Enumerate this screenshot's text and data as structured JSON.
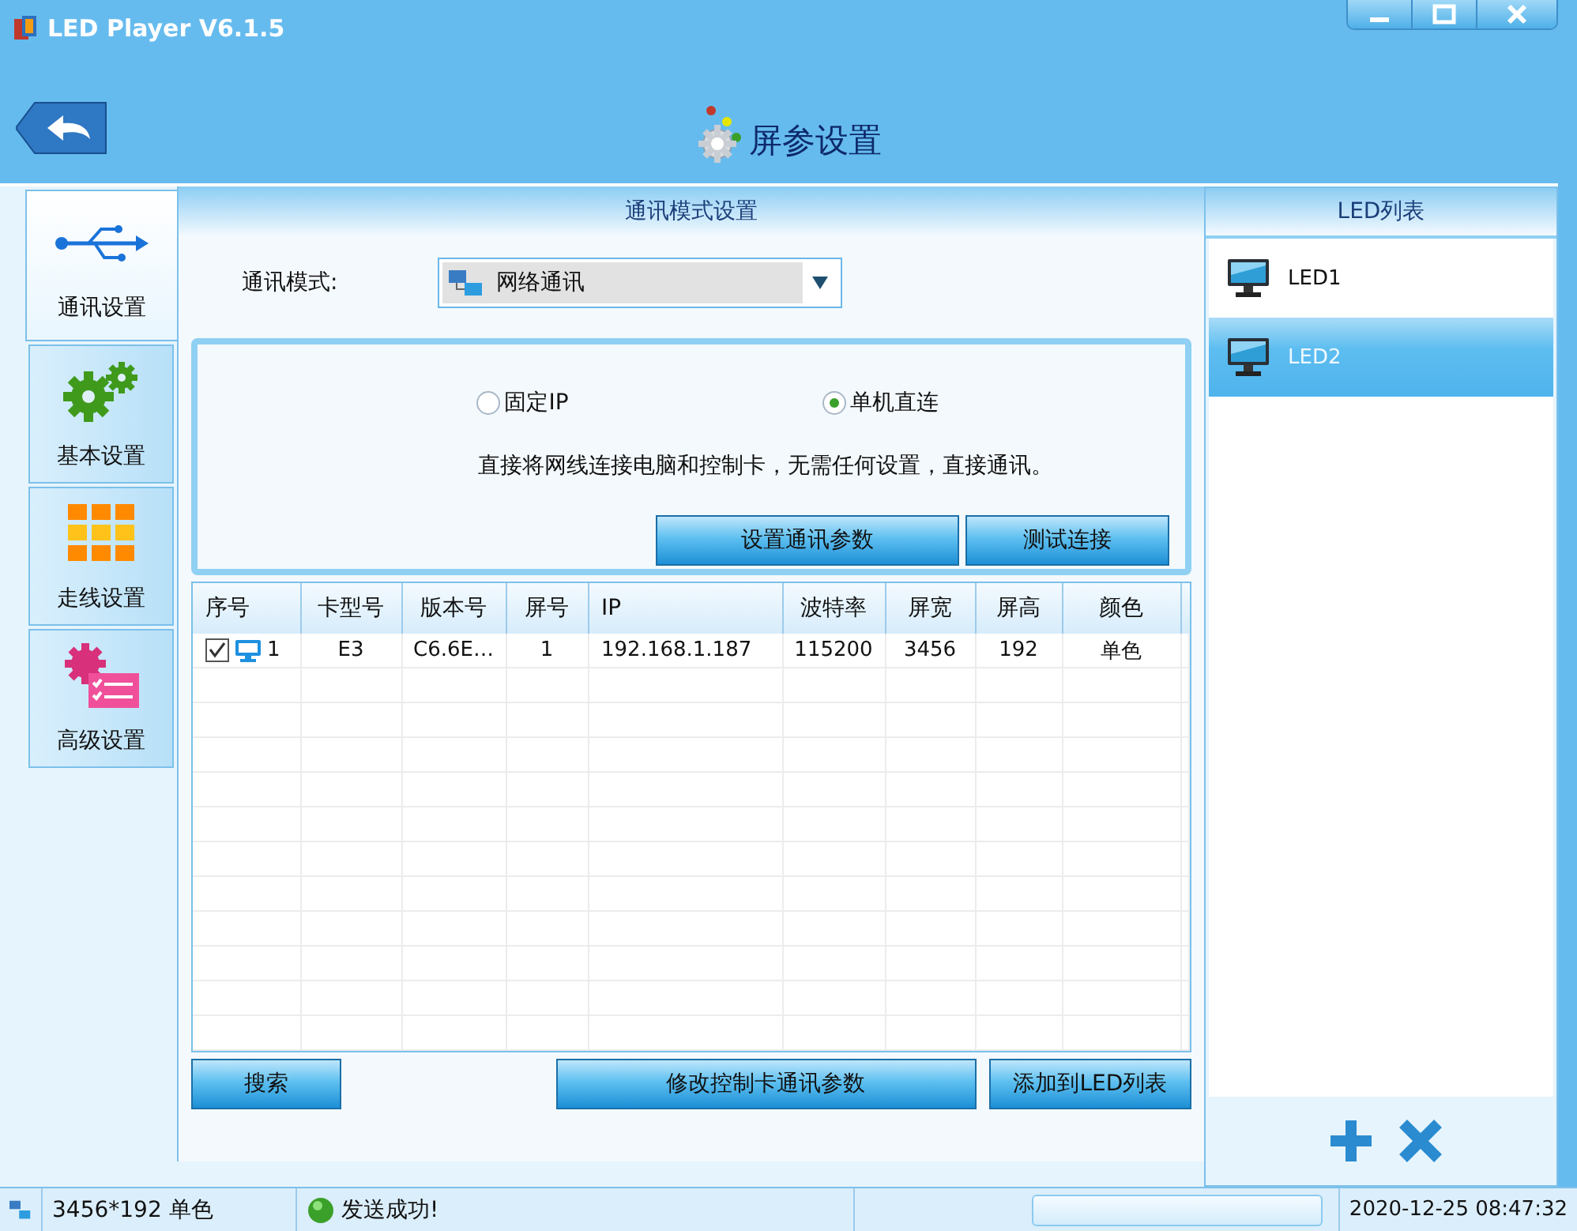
{
  "window": {
    "title": "LED Player V6.1.5"
  },
  "header": {
    "title": "屏参设置"
  },
  "nav": [
    {
      "label": "通讯设置",
      "selected": true,
      "kind": "usb"
    },
    {
      "label": "基本设置",
      "selected": false,
      "kind": "gears"
    },
    {
      "label": "走线设置",
      "selected": false,
      "kind": "grid"
    },
    {
      "label": "高级设置",
      "selected": false,
      "kind": "advanced"
    }
  ],
  "comm": {
    "title": "通讯模式设置",
    "mode_label": "通讯模式:",
    "mode_value": "网络通讯",
    "options": [
      {
        "label": "固定IP",
        "selected": false
      },
      {
        "label": "单机直连",
        "selected": true
      }
    ],
    "description": "直接将网线连接电脑和控制卡，无需任何设置，直接通讯。",
    "buttons": [
      "设置通讯参数",
      "测试连接"
    ]
  },
  "table": {
    "columns": [
      "序号",
      "卡型号",
      "版本号",
      "屏号",
      "IP",
      "波特率",
      "屏宽",
      "屏高",
      "颜色"
    ],
    "rows": [
      {
        "checked": true,
        "cells": [
          "1",
          "E3",
          "C6.6E…",
          "1",
          "192.168.1.187",
          "115200",
          "3456",
          "192",
          "单色"
        ]
      }
    ]
  },
  "bottom_buttons": [
    "搜索",
    "修改控制卡通讯参数",
    "添加到LED列表"
  ],
  "led_list": {
    "title": "LED列表",
    "items": [
      {
        "label": "LED1",
        "selected": false
      },
      {
        "label": "LED2",
        "selected": true
      }
    ]
  },
  "status_bar": {
    "size": "3456*192 单色",
    "message": "发送成功!",
    "time": "2020-12-25 08:47:32",
    "level": 0
  }
}
